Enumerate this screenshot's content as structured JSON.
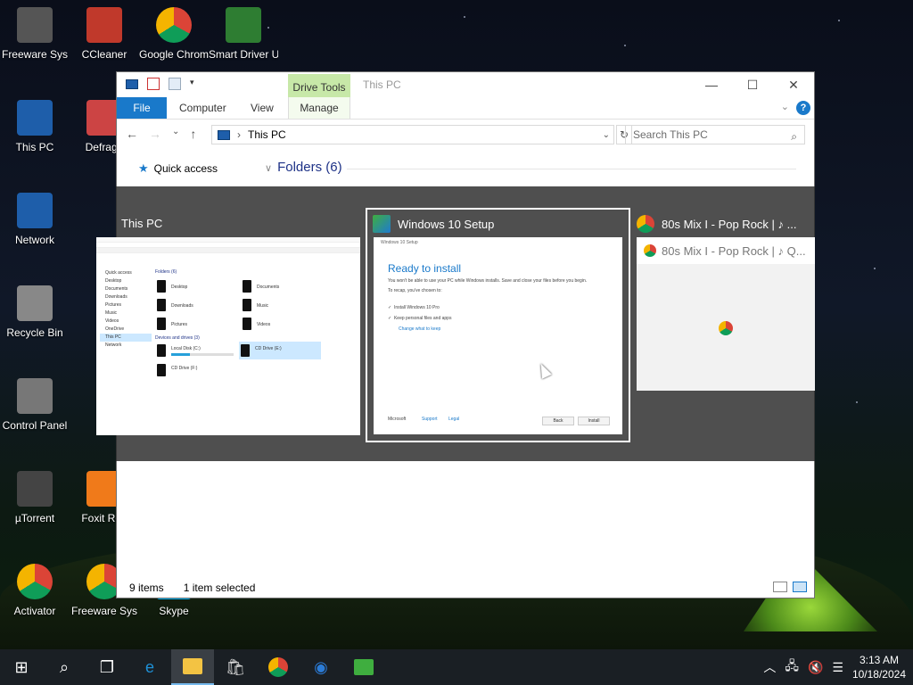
{
  "desktop": {
    "icons": [
      {
        "label": "Freeware Sys",
        "icon": "freeware-icon"
      },
      {
        "label": "CCleaner",
        "icon": "ccleaner-icon"
      },
      {
        "label": "Google Chrome",
        "icon": "chrome-icon"
      },
      {
        "label": "Smart Driver Updater",
        "icon": "driver-icon"
      },
      {
        "label": "This PC",
        "icon": "this-pc-icon"
      },
      {
        "label": "Defragg",
        "icon": "defraggler-icon"
      },
      {
        "label": "Network",
        "icon": "network-icon"
      },
      {
        "label": "Recycle Bin",
        "icon": "recycle-bin-icon"
      },
      {
        "label": "Control Panel",
        "icon": "control-panel-icon"
      },
      {
        "label": "µTorrent",
        "icon": "utorrent-icon"
      },
      {
        "label": "Foxit Rea",
        "icon": "foxit-icon"
      },
      {
        "label": "Activator",
        "icon": "chrome-icon"
      },
      {
        "label": "Freeware Sys",
        "icon": "chrome-icon"
      },
      {
        "label": "Skype",
        "icon": "skype-icon"
      }
    ]
  },
  "explorer": {
    "window_title": "This PC",
    "contextual_tab": "Drive Tools",
    "tabs": [
      "File",
      "Computer",
      "View",
      "Manage"
    ],
    "address": "This PC",
    "search_placeholder": "Search This PC",
    "nav": {
      "quick_access": "Quick access"
    },
    "section_title": "Folders (6)",
    "status": {
      "items": "9 items",
      "selected": "1 item selected"
    }
  },
  "switcher": {
    "tiles": [
      {
        "title": "This PC",
        "icon": "explorer-icon"
      },
      {
        "title": "Windows 10 Setup",
        "icon": "setup-icon",
        "selected": true
      },
      {
        "title": "80s Mix I - Pop Rock | ♪ ...",
        "icon": "chrome-icon"
      }
    ],
    "explorer_thumb": {
      "folders_header": "Folders (6)",
      "folders": [
        "Desktop",
        "Documents",
        "Downloads",
        "Music",
        "Pictures",
        "Videos"
      ],
      "drives_header": "Devices and drives (3)",
      "drives": [
        "Local Disk (C:)",
        "CD Drive (E:)",
        "CD Drive (F:)"
      ],
      "nav": [
        "Quick access",
        "Desktop",
        "Documents",
        "Downloads",
        "Pictures",
        "Music",
        "Videos",
        "OneDrive",
        "This PC",
        "Network"
      ]
    },
    "setup_thumb": {
      "header": "Windows 10 Setup",
      "heading": "Ready to install",
      "lines": [
        "You won't be able to use your PC while Windows installs. Save and close your files before you begin.",
        "To recap, you've chosen to:"
      ],
      "checks": [
        "Install Windows 10 Pro",
        "Keep personal files and apps"
      ],
      "change_link": "Change what to keep",
      "footer": [
        "Microsoft",
        "Support",
        "Legal"
      ],
      "buttons": {
        "back": "Back",
        "install": "Install"
      }
    },
    "chrome_thumb": {
      "tab": "80s Mix I - Pop Rock | ♪ Q..."
    }
  },
  "taskbar": {
    "icons": [
      "start-icon",
      "search-icon",
      "task-view-icon",
      "edge-icon",
      "file-explorer-icon",
      "store-icon",
      "chrome-icon",
      "firefox-icon",
      "setup-icon"
    ],
    "active": "file-explorer-icon",
    "time": "3:13 AM",
    "date": "10/18/2024"
  }
}
